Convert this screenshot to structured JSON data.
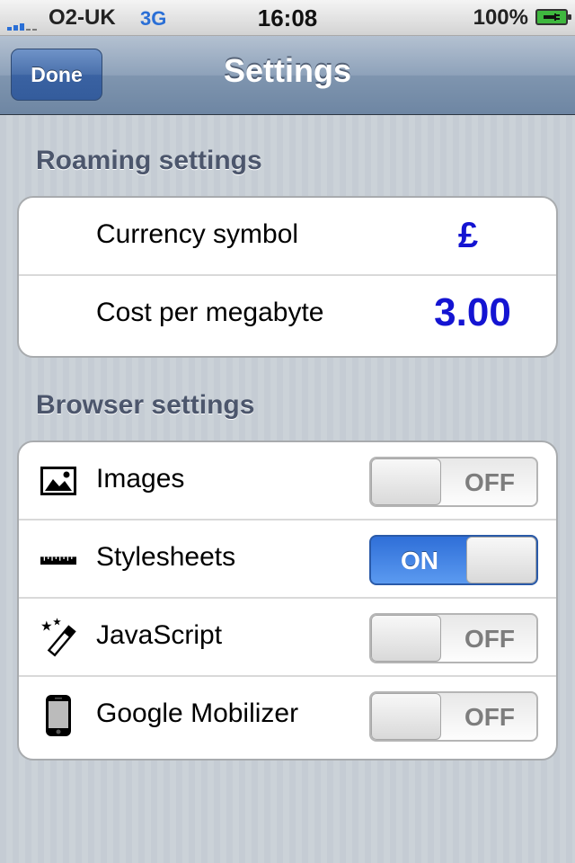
{
  "status_bar": {
    "carrier": "O2-UK",
    "network": "3G",
    "time": "16:08",
    "battery": "100%",
    "signal_icon": "signal-bars-icon",
    "battery_icon": "battery-charging-icon"
  },
  "nav": {
    "done_label": "Done",
    "title": "Settings"
  },
  "roaming": {
    "header": "Roaming settings",
    "currency_label": "Currency symbol",
    "currency_value": "£",
    "cost_label": "Cost per megabyte",
    "cost_value": "3.00"
  },
  "browser": {
    "header": "Browser settings",
    "rows": [
      {
        "label": "Images",
        "icon": "image-icon",
        "state": "OFF"
      },
      {
        "label": "Stylesheets",
        "icon": "ruler-icon",
        "state": "ON"
      },
      {
        "label": "JavaScript",
        "icon": "magic-wand-icon",
        "state": "OFF"
      },
      {
        "label": "Google Mobilizer",
        "icon": "phone-icon",
        "state": "OFF"
      }
    ]
  },
  "colors": {
    "value_blue": "#1414d2",
    "switch_on": "#2f6fd8",
    "nav_bar": "#6e86a3"
  }
}
